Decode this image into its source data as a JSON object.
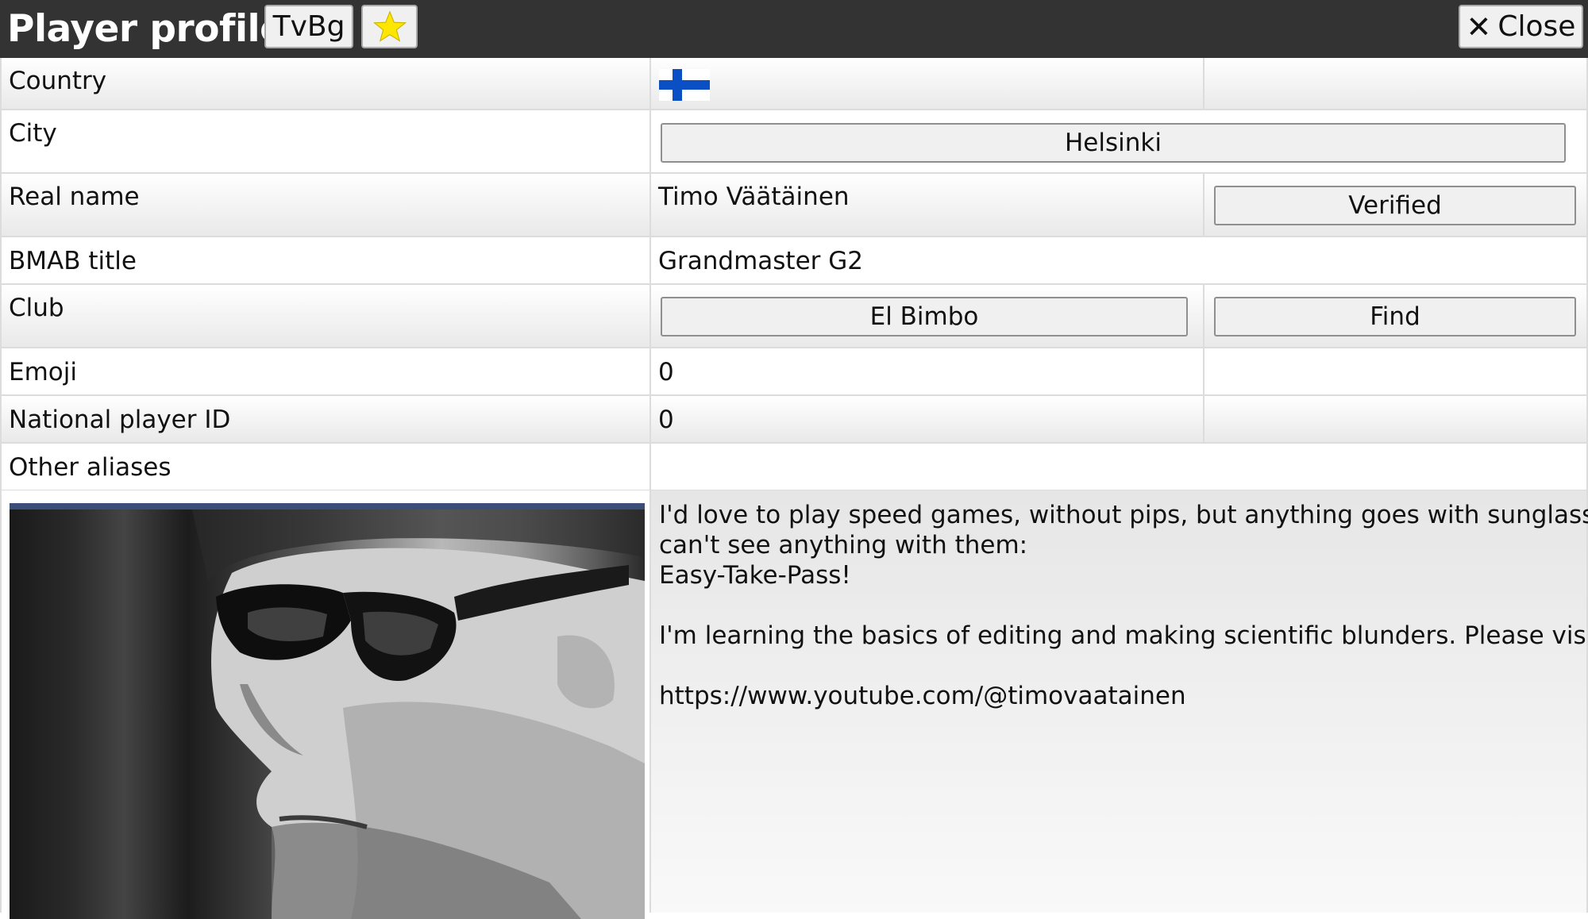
{
  "header": {
    "title": "Player profile:",
    "alias_button": "TvBg",
    "star_icon": "star-icon",
    "close_label": "Close",
    "close_icon": "x-icon"
  },
  "rows": {
    "country": {
      "label": "Country",
      "flag": "finland-flag"
    },
    "city": {
      "label": "City",
      "value": "Helsinki"
    },
    "real_name": {
      "label": "Real name",
      "value": "Timo Väätäinen",
      "verified_label": "Verified"
    },
    "bmab_title": {
      "label": "BMAB title",
      "value": "Grandmaster G2"
    },
    "club": {
      "label": "Club",
      "value": "El Bimbo",
      "find_label": "Find"
    },
    "emoji": {
      "label": "Emoji",
      "value": "0"
    },
    "national_id": {
      "label": "National player ID",
      "value": "0"
    },
    "aliases": {
      "label": "Other aliases",
      "value": ""
    }
  },
  "bio": {
    "lines": [
      "I'd love to play speed games, without pips, but anything goes with sunglasses. I",
      "can't see anything with them:",
      "Easy-Take-Pass!",
      "",
      "I'm learning the basics of editing and making scientific blunders. Please visit:",
      "",
      "https://www.youtube.com/@timovaatainen"
    ]
  },
  "colors": {
    "header_bg": "#333333",
    "star": "#ffe600",
    "flag_blue": "#0a4fc4"
  }
}
